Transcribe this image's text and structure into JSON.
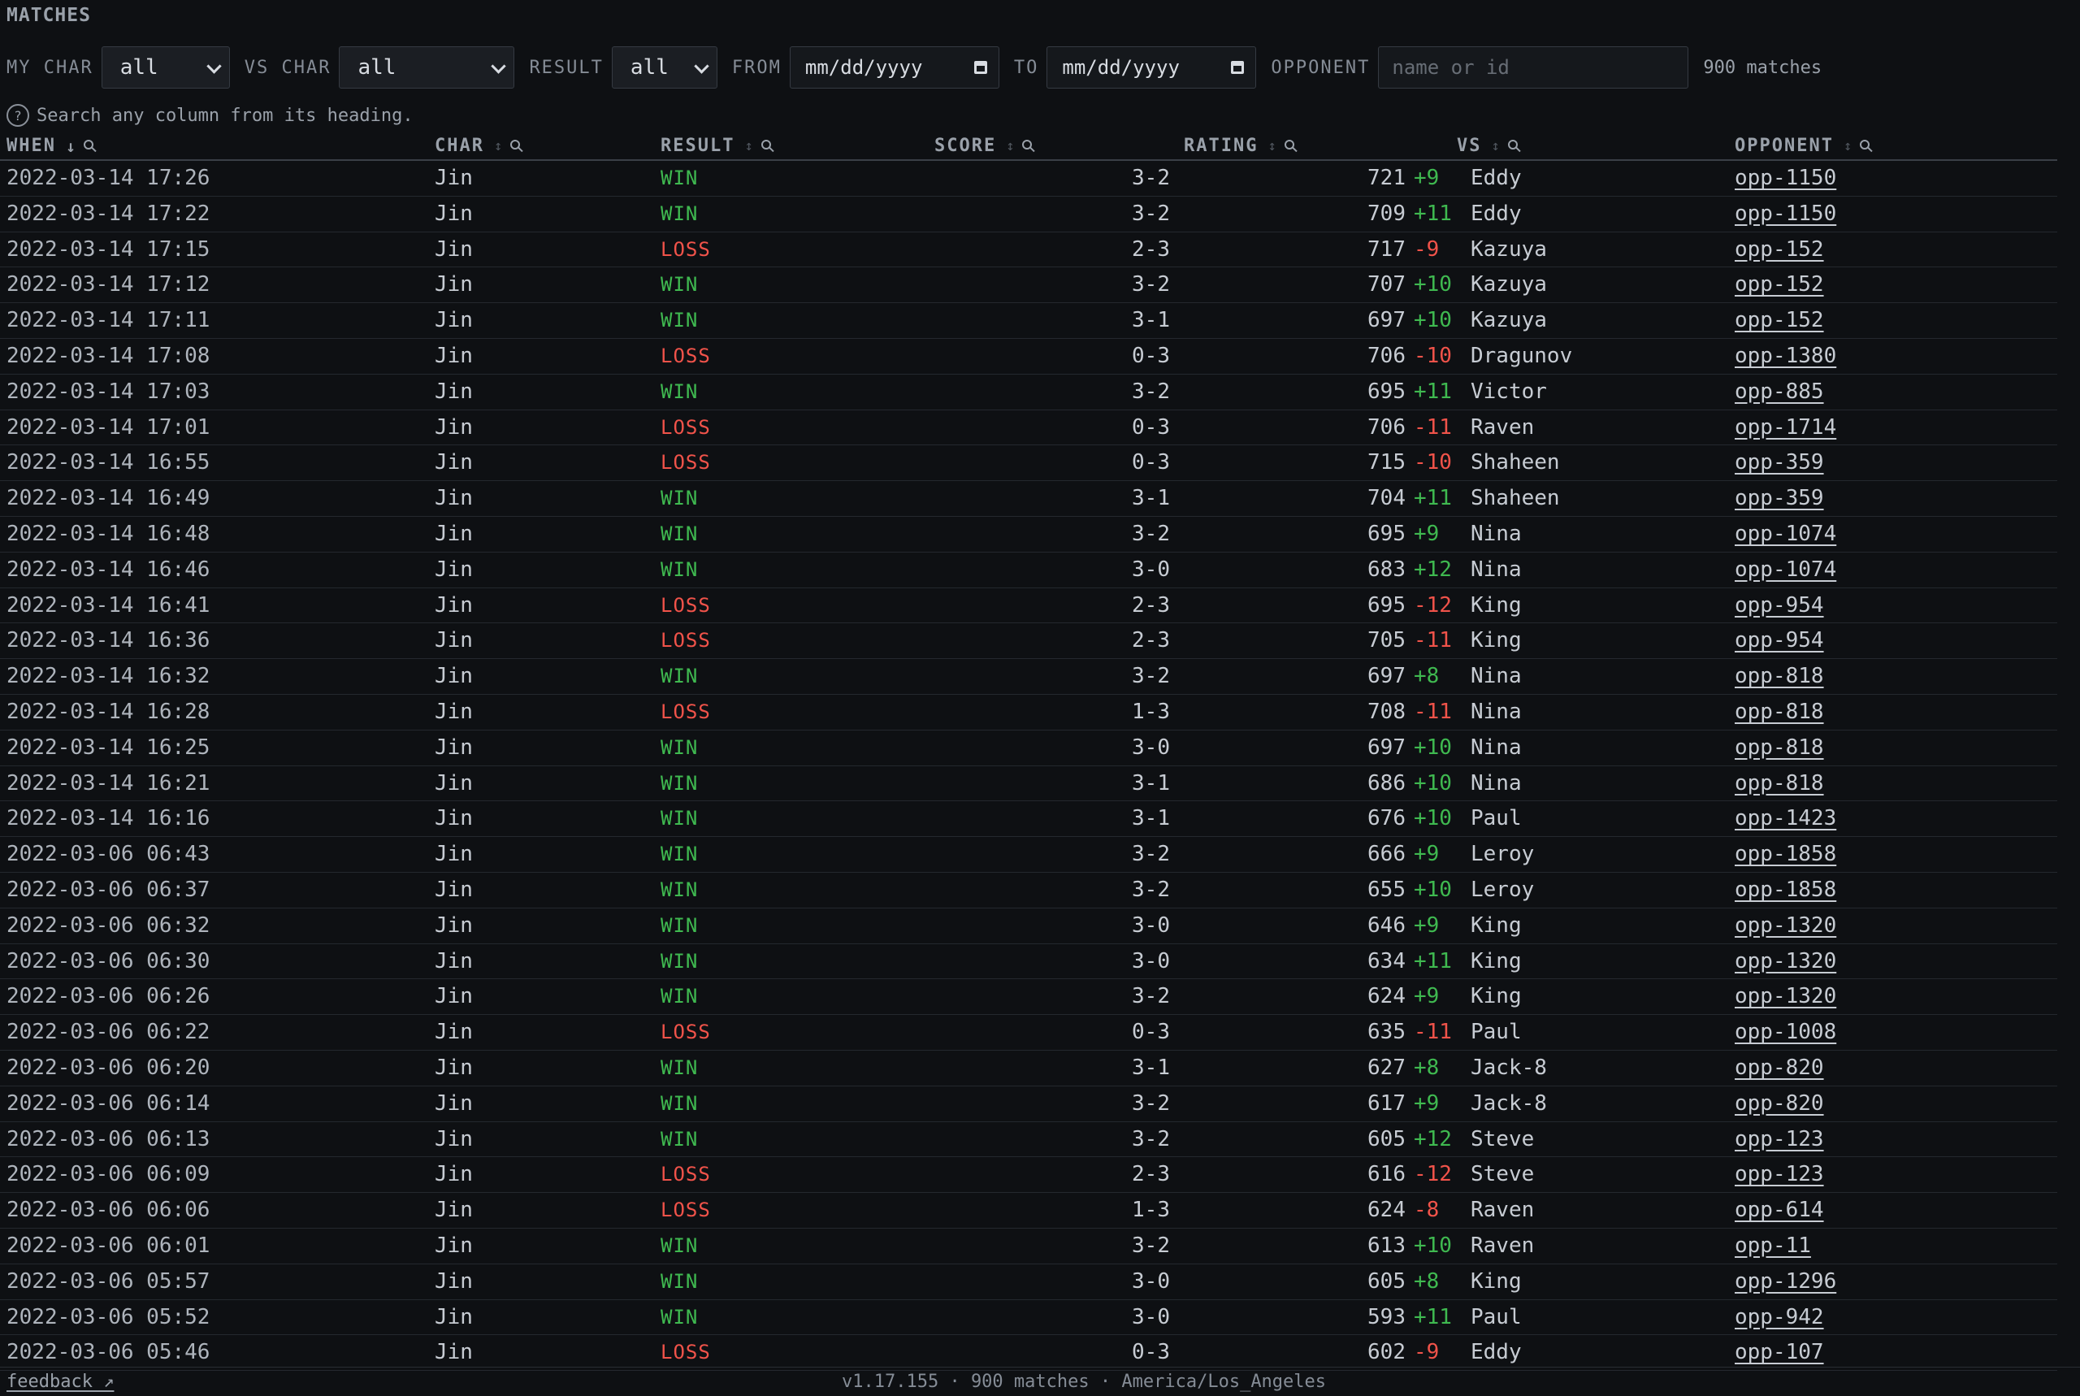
{
  "section_title": "MATCHES",
  "filters": {
    "my_char_label": "MY CHAR",
    "my_char_value": "all",
    "vs_char_label": "VS CHAR",
    "vs_char_value": "all",
    "result_label": "RESULT",
    "result_value": "all",
    "from_label": "FROM",
    "from_value": "mm/dd/yyyy",
    "to_label": "TO",
    "to_value": "mm/dd/yyyy",
    "opponent_label": "OPPONENT",
    "opponent_placeholder": "name or id",
    "count": "900 matches"
  },
  "hint": {
    "icon": "?",
    "text": "Search any column from its heading."
  },
  "columns": {
    "when": "WHEN",
    "when_sort": "↓",
    "char": "CHAR",
    "char_sort": "↕",
    "result": "RESULT",
    "result_sort": "↕",
    "score": "SCORE",
    "score_sort": "↕",
    "rating": "RATING",
    "rating_sort": "↕",
    "vs": "VS",
    "vs_sort": "↕",
    "opponent": "OPPONENT",
    "opponent_sort": "↕"
  },
  "colors": {
    "win": "#3fb950",
    "loss": "#f0534a",
    "background": "#0e1013"
  },
  "rows": [
    {
      "when": "2022-03-14 17:26",
      "char": "Jin",
      "result": "WIN",
      "score": "3-2",
      "rating": "721",
      "delta": "+9",
      "vs": "Eddy",
      "opponent": "opp-1150"
    },
    {
      "when": "2022-03-14 17:22",
      "char": "Jin",
      "result": "WIN",
      "score": "3-2",
      "rating": "709",
      "delta": "+11",
      "vs": "Eddy",
      "opponent": "opp-1150"
    },
    {
      "when": "2022-03-14 17:15",
      "char": "Jin",
      "result": "LOSS",
      "score": "2-3",
      "rating": "717",
      "delta": "-9",
      "vs": "Kazuya",
      "opponent": "opp-152"
    },
    {
      "when": "2022-03-14 17:12",
      "char": "Jin",
      "result": "WIN",
      "score": "3-2",
      "rating": "707",
      "delta": "+10",
      "vs": "Kazuya",
      "opponent": "opp-152"
    },
    {
      "when": "2022-03-14 17:11",
      "char": "Jin",
      "result": "WIN",
      "score": "3-1",
      "rating": "697",
      "delta": "+10",
      "vs": "Kazuya",
      "opponent": "opp-152"
    },
    {
      "when": "2022-03-14 17:08",
      "char": "Jin",
      "result": "LOSS",
      "score": "0-3",
      "rating": "706",
      "delta": "-10",
      "vs": "Dragunov",
      "opponent": "opp-1380"
    },
    {
      "when": "2022-03-14 17:03",
      "char": "Jin",
      "result": "WIN",
      "score": "3-2",
      "rating": "695",
      "delta": "+11",
      "vs": "Victor",
      "opponent": "opp-885"
    },
    {
      "when": "2022-03-14 17:01",
      "char": "Jin",
      "result": "LOSS",
      "score": "0-3",
      "rating": "706",
      "delta": "-11",
      "vs": "Raven",
      "opponent": "opp-1714"
    },
    {
      "when": "2022-03-14 16:55",
      "char": "Jin",
      "result": "LOSS",
      "score": "0-3",
      "rating": "715",
      "delta": "-10",
      "vs": "Shaheen",
      "opponent": "opp-359"
    },
    {
      "when": "2022-03-14 16:49",
      "char": "Jin",
      "result": "WIN",
      "score": "3-1",
      "rating": "704",
      "delta": "+11",
      "vs": "Shaheen",
      "opponent": "opp-359"
    },
    {
      "when": "2022-03-14 16:48",
      "char": "Jin",
      "result": "WIN",
      "score": "3-2",
      "rating": "695",
      "delta": "+9",
      "vs": "Nina",
      "opponent": "opp-1074"
    },
    {
      "when": "2022-03-14 16:46",
      "char": "Jin",
      "result": "WIN",
      "score": "3-0",
      "rating": "683",
      "delta": "+12",
      "vs": "Nina",
      "opponent": "opp-1074"
    },
    {
      "when": "2022-03-14 16:41",
      "char": "Jin",
      "result": "LOSS",
      "score": "2-3",
      "rating": "695",
      "delta": "-12",
      "vs": "King",
      "opponent": "opp-954"
    },
    {
      "when": "2022-03-14 16:36",
      "char": "Jin",
      "result": "LOSS",
      "score": "2-3",
      "rating": "705",
      "delta": "-11",
      "vs": "King",
      "opponent": "opp-954"
    },
    {
      "when": "2022-03-14 16:32",
      "char": "Jin",
      "result": "WIN",
      "score": "3-2",
      "rating": "697",
      "delta": "+8",
      "vs": "Nina",
      "opponent": "opp-818"
    },
    {
      "when": "2022-03-14 16:28",
      "char": "Jin",
      "result": "LOSS",
      "score": "1-3",
      "rating": "708",
      "delta": "-11",
      "vs": "Nina",
      "opponent": "opp-818"
    },
    {
      "when": "2022-03-14 16:25",
      "char": "Jin",
      "result": "WIN",
      "score": "3-0",
      "rating": "697",
      "delta": "+10",
      "vs": "Nina",
      "opponent": "opp-818"
    },
    {
      "when": "2022-03-14 16:21",
      "char": "Jin",
      "result": "WIN",
      "score": "3-1",
      "rating": "686",
      "delta": "+10",
      "vs": "Nina",
      "opponent": "opp-818"
    },
    {
      "when": "2022-03-14 16:16",
      "char": "Jin",
      "result": "WIN",
      "score": "3-1",
      "rating": "676",
      "delta": "+10",
      "vs": "Paul",
      "opponent": "opp-1423"
    },
    {
      "when": "2022-03-06 06:43",
      "char": "Jin",
      "result": "WIN",
      "score": "3-2",
      "rating": "666",
      "delta": "+9",
      "vs": "Leroy",
      "opponent": "opp-1858"
    },
    {
      "when": "2022-03-06 06:37",
      "char": "Jin",
      "result": "WIN",
      "score": "3-2",
      "rating": "655",
      "delta": "+10",
      "vs": "Leroy",
      "opponent": "opp-1858"
    },
    {
      "when": "2022-03-06 06:32",
      "char": "Jin",
      "result": "WIN",
      "score": "3-0",
      "rating": "646",
      "delta": "+9",
      "vs": "King",
      "opponent": "opp-1320"
    },
    {
      "when": "2022-03-06 06:30",
      "char": "Jin",
      "result": "WIN",
      "score": "3-0",
      "rating": "634",
      "delta": "+11",
      "vs": "King",
      "opponent": "opp-1320"
    },
    {
      "when": "2022-03-06 06:26",
      "char": "Jin",
      "result": "WIN",
      "score": "3-2",
      "rating": "624",
      "delta": "+9",
      "vs": "King",
      "opponent": "opp-1320"
    },
    {
      "when": "2022-03-06 06:22",
      "char": "Jin",
      "result": "LOSS",
      "score": "0-3",
      "rating": "635",
      "delta": "-11",
      "vs": "Paul",
      "opponent": "opp-1008"
    },
    {
      "when": "2022-03-06 06:20",
      "char": "Jin",
      "result": "WIN",
      "score": "3-1",
      "rating": "627",
      "delta": "+8",
      "vs": "Jack-8",
      "opponent": "opp-820"
    },
    {
      "when": "2022-03-06 06:14",
      "char": "Jin",
      "result": "WIN",
      "score": "3-2",
      "rating": "617",
      "delta": "+9",
      "vs": "Jack-8",
      "opponent": "opp-820"
    },
    {
      "when": "2022-03-06 06:13",
      "char": "Jin",
      "result": "WIN",
      "score": "3-2",
      "rating": "605",
      "delta": "+12",
      "vs": "Steve",
      "opponent": "opp-123"
    },
    {
      "when": "2022-03-06 06:09",
      "char": "Jin",
      "result": "LOSS",
      "score": "2-3",
      "rating": "616",
      "delta": "-12",
      "vs": "Steve",
      "opponent": "opp-123"
    },
    {
      "when": "2022-03-06 06:06",
      "char": "Jin",
      "result": "LOSS",
      "score": "1-3",
      "rating": "624",
      "delta": "-8",
      "vs": "Raven",
      "opponent": "opp-614"
    },
    {
      "when": "2022-03-06 06:01",
      "char": "Jin",
      "result": "WIN",
      "score": "3-2",
      "rating": "613",
      "delta": "+10",
      "vs": "Raven",
      "opponent": "opp-11"
    },
    {
      "when": "2022-03-06 05:57",
      "char": "Jin",
      "result": "WIN",
      "score": "3-0",
      "rating": "605",
      "delta": "+8",
      "vs": "King",
      "opponent": "opp-1296"
    },
    {
      "when": "2022-03-06 05:52",
      "char": "Jin",
      "result": "WIN",
      "score": "3-0",
      "rating": "593",
      "delta": "+11",
      "vs": "Paul",
      "opponent": "opp-942"
    },
    {
      "when": "2022-03-06 05:46",
      "char": "Jin",
      "result": "LOSS",
      "score": "0-3",
      "rating": "602",
      "delta": "-9",
      "vs": "Eddy",
      "opponent": "opp-107"
    }
  ],
  "footer": {
    "feedback": "feedback ↗",
    "info": "v1.17.155 · 900 matches · America/Los_Angeles"
  }
}
